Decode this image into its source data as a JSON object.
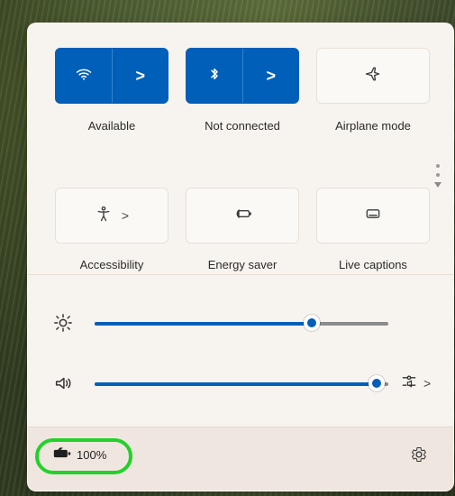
{
  "quick_settings": {
    "tiles": [
      {
        "id": "wifi",
        "label": "Available",
        "state": "on",
        "has_chevron": true,
        "icon": "wifi-icon"
      },
      {
        "id": "bluetooth",
        "label": "Not connected",
        "state": "on",
        "has_chevron": true,
        "icon": "bluetooth-icon"
      },
      {
        "id": "airplane",
        "label": "Airplane mode",
        "state": "off",
        "has_chevron": false,
        "icon": "airplane-icon"
      },
      {
        "id": "accessibility",
        "label": "Accessibility",
        "state": "off",
        "has_chevron": true,
        "icon": "accessibility-icon"
      },
      {
        "id": "energy_saver",
        "label": "Energy saver",
        "state": "off",
        "has_chevron": false,
        "icon": "energy-saver-icon"
      },
      {
        "id": "live_captions",
        "label": "Live captions",
        "state": "off",
        "has_chevron": false,
        "icon": "live-captions-icon"
      }
    ],
    "chevron_glyph": ">",
    "sliders": {
      "brightness": {
        "value_fraction": 0.74,
        "icon": "brightness-icon"
      },
      "volume": {
        "value_fraction": 0.96,
        "icon": "volume-icon",
        "has_output_selector": true
      }
    },
    "footer": {
      "battery_text": "100%",
      "battery_icon": "battery-icon",
      "settings_icon": "gear-icon"
    },
    "colors": {
      "accent": "#005fb8",
      "highlight": "#22d12a"
    }
  }
}
